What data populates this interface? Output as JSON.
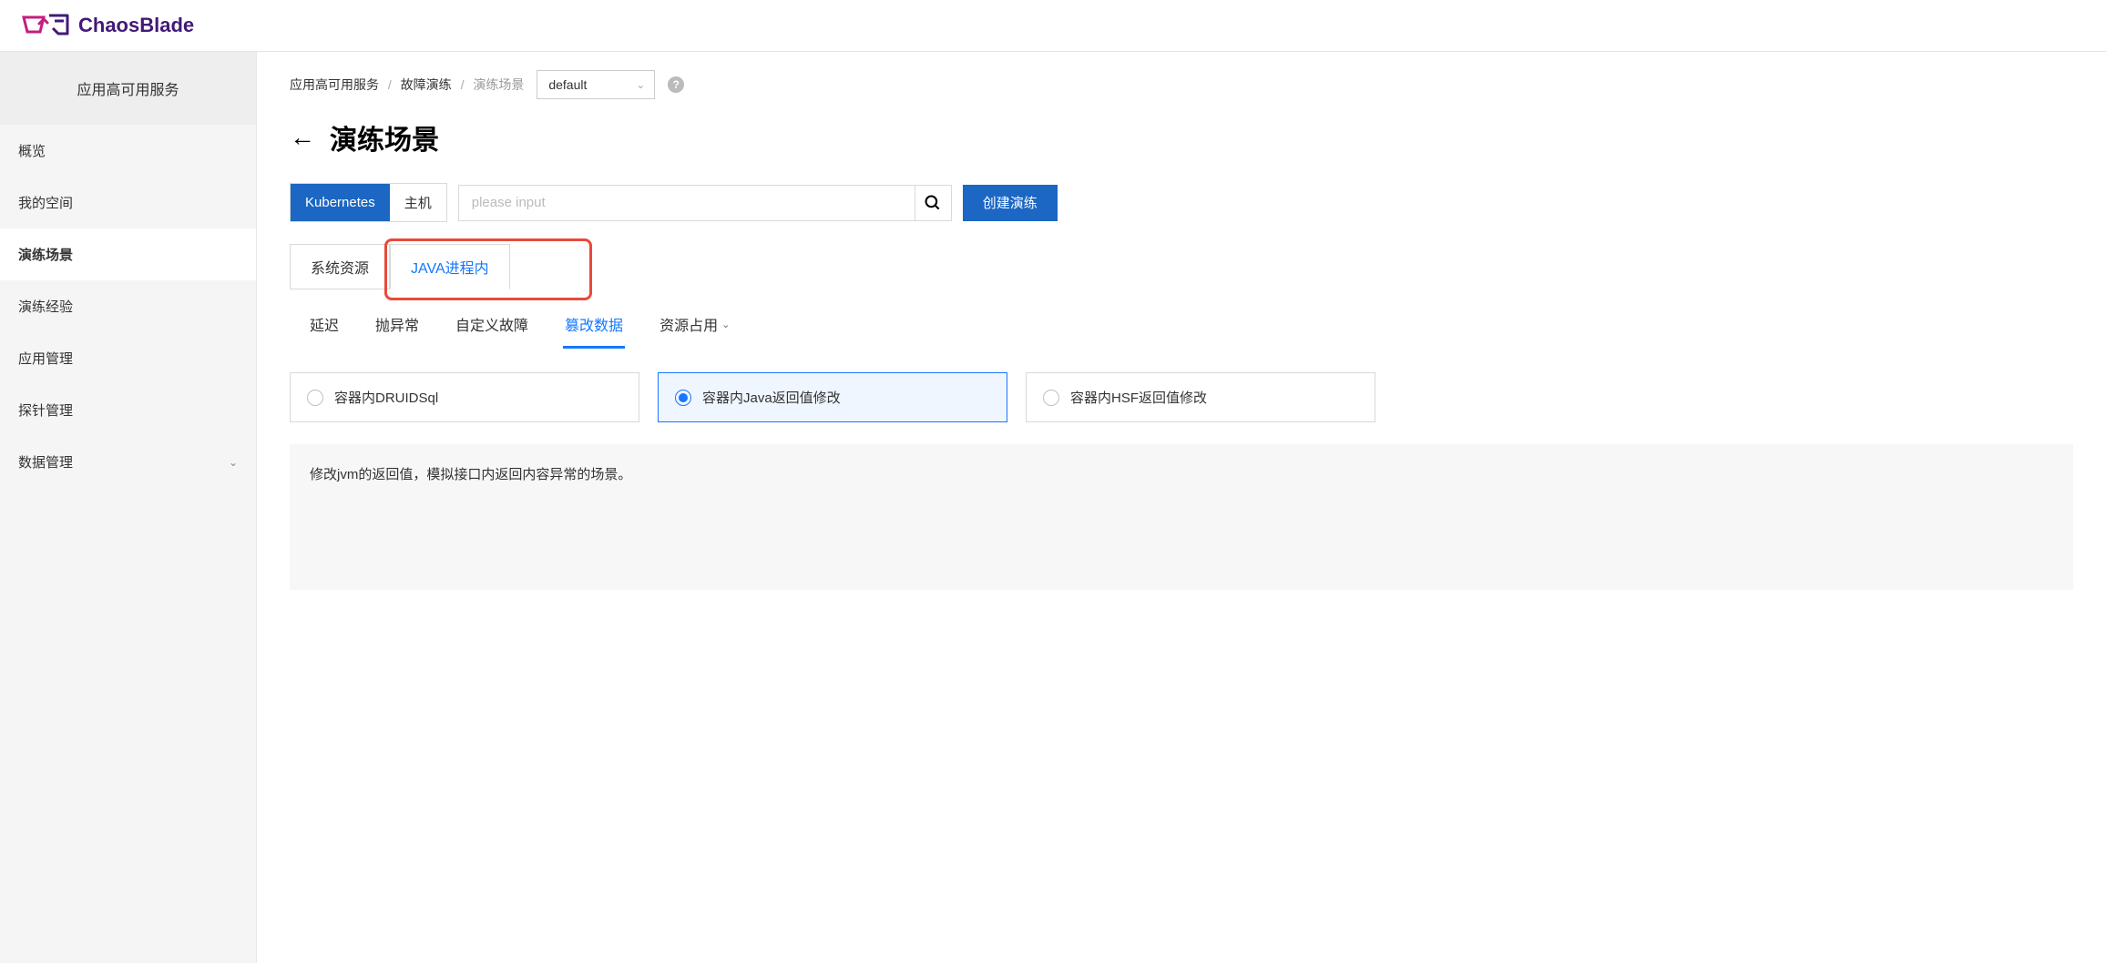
{
  "brand": {
    "name": "ChaosBlade"
  },
  "sidebar": {
    "header": "应用高可用服务",
    "items": [
      {
        "label": "概览"
      },
      {
        "label": "我的空间"
      },
      {
        "label": "演练场景"
      },
      {
        "label": "演练经验"
      },
      {
        "label": "应用管理"
      },
      {
        "label": "探针管理"
      },
      {
        "label": "数据管理",
        "hasChildren": true
      }
    ],
    "activeIndex": 2
  },
  "breadcrumb": {
    "items": [
      "应用高可用服务",
      "故障演练",
      "演练场景"
    ]
  },
  "namespaceSelect": {
    "value": "default"
  },
  "pageTitle": "演练场景",
  "envTabs": {
    "items": [
      "Kubernetes",
      "主机"
    ],
    "activeIndex": 0
  },
  "search": {
    "placeholder": "please input"
  },
  "createBtn": "创建演练",
  "categoryTabs": {
    "items": [
      "系统资源",
      "JAVA进程内"
    ],
    "activeIndex": 1
  },
  "subTabs": {
    "items": [
      {
        "label": "延迟"
      },
      {
        "label": "抛异常"
      },
      {
        "label": "自定义故障"
      },
      {
        "label": "篡改数据"
      },
      {
        "label": "资源占用",
        "dropdown": true
      }
    ],
    "activeIndex": 3
  },
  "options": {
    "items": [
      {
        "label": "容器内DRUIDSql"
      },
      {
        "label": "容器内Java返回值修改"
      },
      {
        "label": "容器内HSF返回值修改"
      }
    ],
    "selectedIndex": 1
  },
  "description": "修改jvm的返回值，模拟接口内返回内容异常的场景。"
}
